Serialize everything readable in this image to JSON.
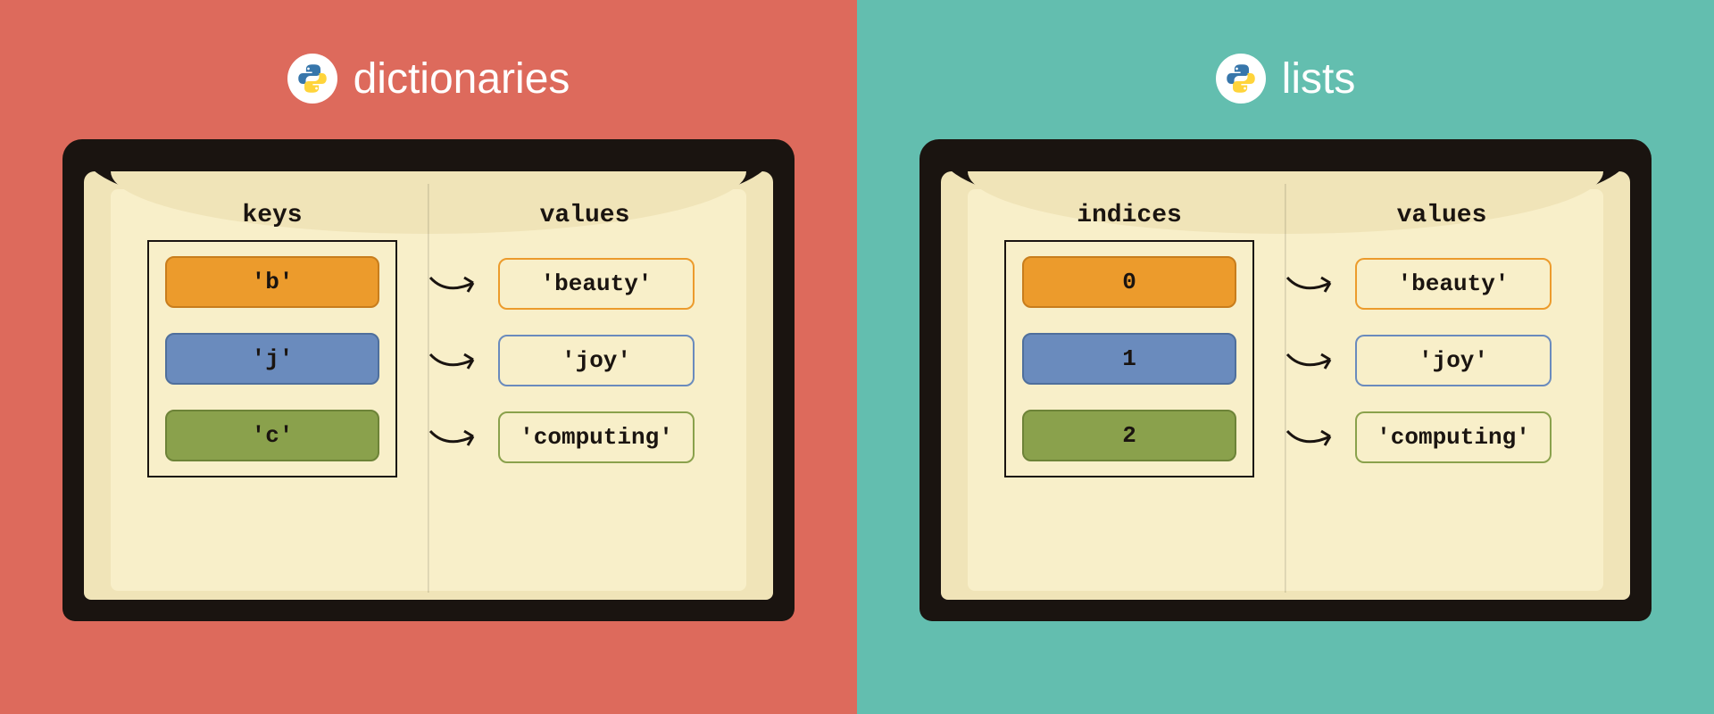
{
  "left": {
    "title": "dictionaries",
    "left_heading": "keys",
    "right_heading": "values",
    "rows": [
      {
        "key": "'b'",
        "value": "'beauty'",
        "color": "orange"
      },
      {
        "key": "'j'",
        "value": "'joy'",
        "color": "blue"
      },
      {
        "key": "'c'",
        "value": "'computing'",
        "color": "green"
      }
    ]
  },
  "right": {
    "title": "lists",
    "left_heading": "indices",
    "right_heading": "values",
    "rows": [
      {
        "key": "0",
        "value": "'beauty'",
        "color": "orange"
      },
      {
        "key": "1",
        "value": "'joy'",
        "color": "blue"
      },
      {
        "key": "2",
        "value": "'computing'",
        "color": "green"
      }
    ]
  },
  "colors": {
    "orange": "#ec9b2c",
    "blue": "#6a8bbd",
    "green": "#8aa14c"
  }
}
